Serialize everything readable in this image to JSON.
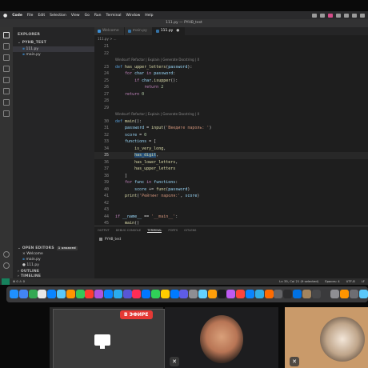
{
  "menubar": {
    "items": [
      "Code",
      "File",
      "Edit",
      "Selection",
      "View",
      "Go",
      "Run",
      "Terminal",
      "Window",
      "Help"
    ]
  },
  "window": {
    "title": "111.py — PYHB_test"
  },
  "sidebar": {
    "explorer_label": "EXPLORER",
    "folder": "PYHB_TEST",
    "files": [
      "111.py",
      "main.py"
    ],
    "open_editors_label": "OPEN EDITORS",
    "unsaved_badge": "1 unsaved",
    "open_files": [
      "Welcome",
      "main.py",
      "111.py"
    ],
    "outline_label": "OUTLINE",
    "timeline_label": "TIMELINE"
  },
  "tabs": [
    {
      "label": "Welcome",
      "active": false
    },
    {
      "label": "main.py",
      "active": false
    },
    {
      "label": "111.py",
      "active": true
    }
  ],
  "breadcrumb": "111.py > ...",
  "code": {
    "lines": [
      {
        "n": "21",
        "parts": []
      },
      {
        "n": "22",
        "parts": []
      },
      {
        "n": "",
        "hint": "Windsurf: Refactor | Explain | Generate Docstring | X"
      },
      {
        "n": "23",
        "parts": [
          [
            "def",
            "def "
          ],
          [
            "fn",
            "has_upper_letters"
          ],
          [
            "plain",
            "("
          ],
          [
            "var",
            "password"
          ],
          [
            "plain",
            "):"
          ]
        ]
      },
      {
        "n": "24",
        "parts": [
          [
            "plain",
            "    "
          ],
          [
            "kw",
            "for "
          ],
          [
            "var",
            "char "
          ],
          [
            "kw",
            "in "
          ],
          [
            "var",
            "password"
          ],
          [
            "plain",
            ":"
          ]
        ]
      },
      {
        "n": "25",
        "parts": [
          [
            "plain",
            "        "
          ],
          [
            "kw",
            "if "
          ],
          [
            "var",
            "char"
          ],
          [
            "plain",
            "."
          ],
          [
            "fn",
            "isupper"
          ],
          [
            "plain",
            "():"
          ]
        ]
      },
      {
        "n": "26",
        "parts": [
          [
            "plain",
            "            "
          ],
          [
            "kw",
            "return "
          ],
          [
            "num",
            "2"
          ]
        ]
      },
      {
        "n": "27",
        "parts": [
          [
            "plain",
            "    "
          ],
          [
            "kw",
            "return "
          ],
          [
            "num",
            "0"
          ]
        ]
      },
      {
        "n": "28",
        "parts": []
      },
      {
        "n": "29",
        "parts": []
      },
      {
        "n": "",
        "hint": "Windsurf: Refactor | Explain | Generate Docstring | X"
      },
      {
        "n": "30",
        "parts": [
          [
            "def",
            "def "
          ],
          [
            "fn",
            "main"
          ],
          [
            "plain",
            "():"
          ]
        ]
      },
      {
        "n": "31",
        "parts": [
          [
            "plain",
            "    "
          ],
          [
            "var",
            "password "
          ],
          [
            "plain",
            "= "
          ],
          [
            "fn",
            "input"
          ],
          [
            "plain",
            "("
          ],
          [
            "str",
            "'Введите пароль: '"
          ],
          [
            "plain",
            ")"
          ]
        ]
      },
      {
        "n": "32",
        "parts": [
          [
            "plain",
            "    "
          ],
          [
            "var",
            "score "
          ],
          [
            "plain",
            "= "
          ],
          [
            "num",
            "0"
          ]
        ]
      },
      {
        "n": "33",
        "parts": [
          [
            "plain",
            "    "
          ],
          [
            "var",
            "functions "
          ],
          [
            "plain",
            "= ["
          ]
        ]
      },
      {
        "n": "34",
        "parts": [
          [
            "plain",
            "        "
          ],
          [
            "fn",
            "is_very_long"
          ],
          [
            "plain",
            ","
          ]
        ]
      },
      {
        "n": "35",
        "cur": true,
        "parts": [
          [
            "plain",
            "        "
          ],
          [
            "fn sel",
            "has_digit"
          ],
          [
            "plain",
            ","
          ]
        ]
      },
      {
        "n": "36",
        "parts": [
          [
            "plain",
            "        "
          ],
          [
            "fn",
            "has_lower_letters"
          ],
          [
            "plain",
            ","
          ]
        ]
      },
      {
        "n": "37",
        "parts": [
          [
            "plain",
            "        "
          ],
          [
            "fn",
            "has_upper_letters"
          ]
        ]
      },
      {
        "n": "38",
        "parts": [
          [
            "plain",
            "    ]"
          ]
        ]
      },
      {
        "n": "39",
        "parts": [
          [
            "plain",
            "    "
          ],
          [
            "kw",
            "for "
          ],
          [
            "var",
            "func "
          ],
          [
            "kw",
            "in "
          ],
          [
            "var",
            "functions"
          ],
          [
            "plain",
            ":"
          ]
        ]
      },
      {
        "n": "40",
        "parts": [
          [
            "plain",
            "        "
          ],
          [
            "var",
            "score "
          ],
          [
            "plain",
            "+= "
          ],
          [
            "fn",
            "func"
          ],
          [
            "plain",
            "("
          ],
          [
            "var",
            "password"
          ],
          [
            "plain",
            ")"
          ]
        ]
      },
      {
        "n": "41",
        "parts": [
          [
            "plain",
            "    "
          ],
          [
            "fn",
            "print"
          ],
          [
            "plain",
            "("
          ],
          [
            "str",
            "'Рейтинг пароля:'"
          ],
          [
            "plain",
            ", "
          ],
          [
            "var",
            "score"
          ],
          [
            "plain",
            ")"
          ]
        ]
      },
      {
        "n": "42",
        "parts": []
      },
      {
        "n": "43",
        "parts": []
      },
      {
        "n": "44",
        "parts": [
          [
            "kw",
            "if "
          ],
          [
            "var",
            "__name__ "
          ],
          [
            "plain",
            "== "
          ],
          [
            "str",
            "'__main__'"
          ],
          [
            "plain",
            ":"
          ]
        ]
      },
      {
        "n": "45",
        "parts": [
          [
            "plain",
            "    "
          ],
          [
            "fn",
            "main"
          ],
          [
            "plain",
            "()"
          ]
        ]
      },
      {
        "n": "46",
        "parts": []
      }
    ]
  },
  "panel": {
    "tabs": [
      {
        "label": "OUTPUT",
        "active": false
      },
      {
        "label": "DEBUG CONSOLE",
        "active": false
      },
      {
        "label": "TERMINAL",
        "active": true
      },
      {
        "label": "PORTS",
        "active": false
      },
      {
        "label": "GITLENS",
        "active": false
      }
    ],
    "terminal_label": "PYHB_test"
  },
  "statusbar": {
    "left": "⊗ 0 ⚠ 0",
    "cursor": "Ln 35, Col 21 (9 selected)",
    "spaces": "Spaces: 4",
    "encoding": "UTF-8",
    "eol": "LF"
  },
  "call": {
    "live_label": "В ЭФИРЕ"
  },
  "colors": {
    "accent_blue": "#007acc",
    "live_red": "#e53935",
    "status_green": "#16825d"
  }
}
